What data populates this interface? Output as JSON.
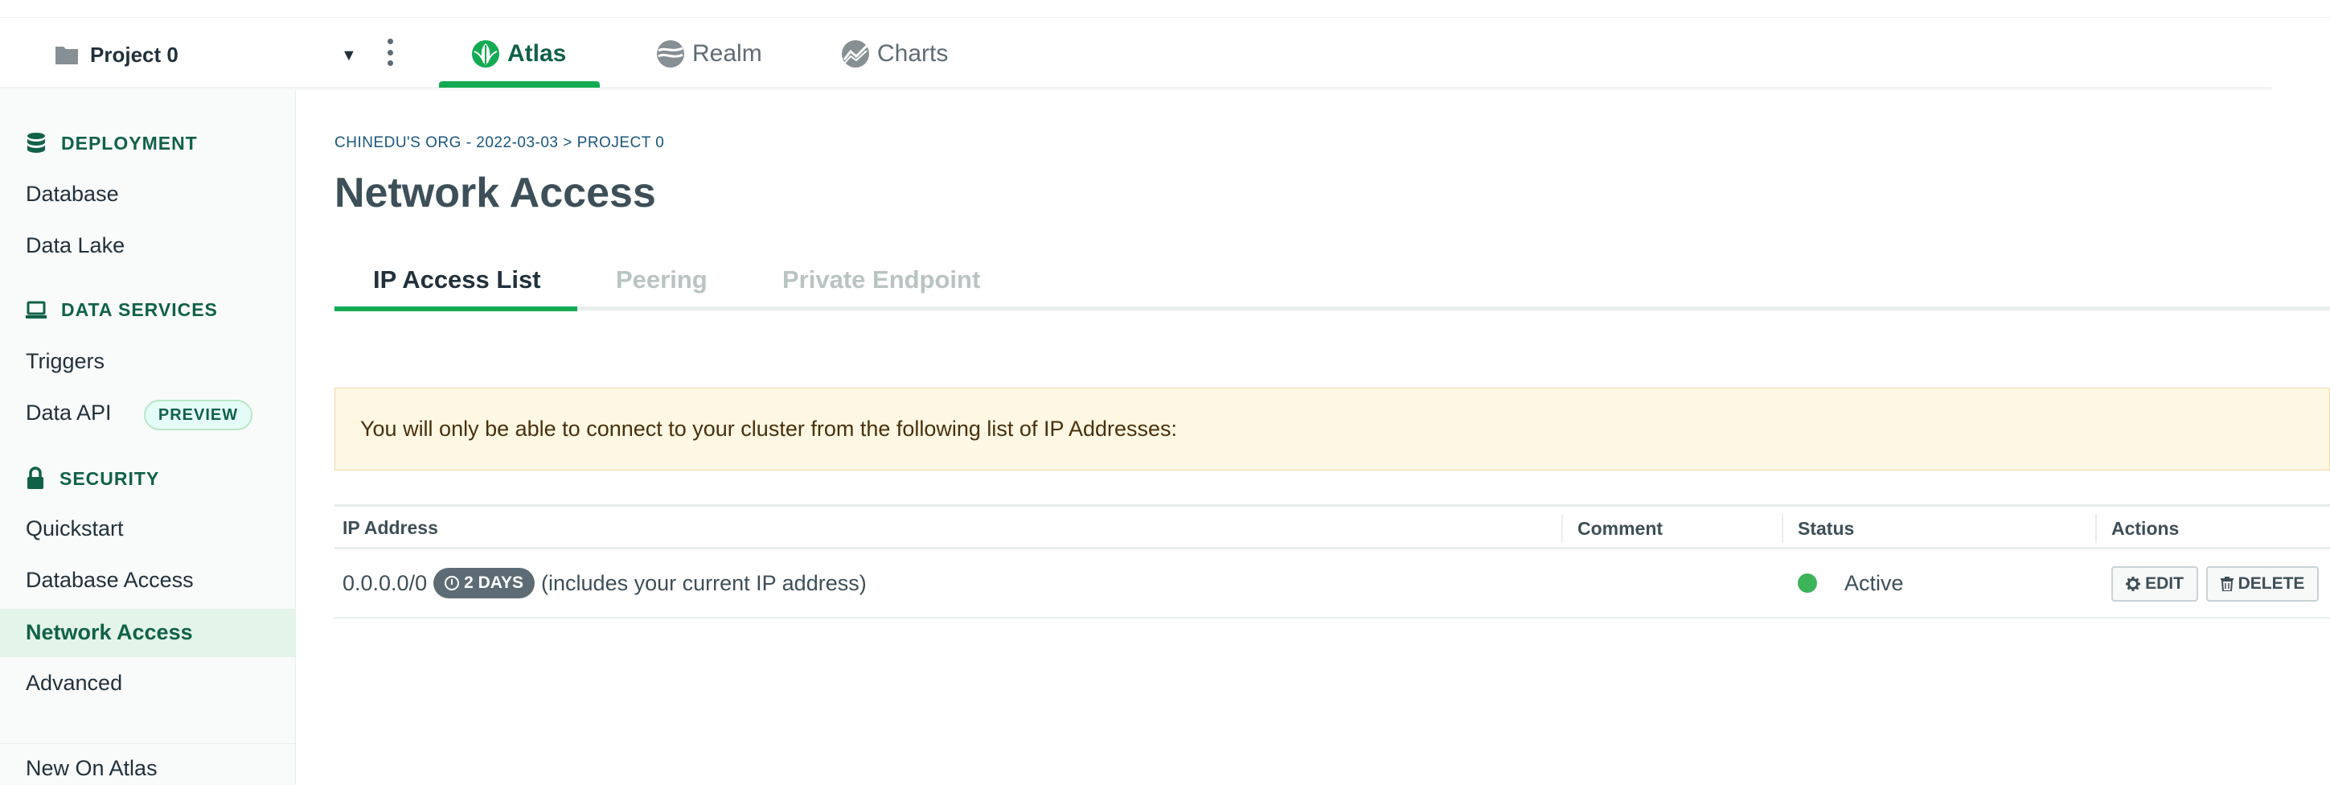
{
  "topbar": {
    "project_name": "Project 0",
    "tabs": [
      {
        "label": "Atlas",
        "active": true
      },
      {
        "label": "Realm",
        "active": false
      },
      {
        "label": "Charts",
        "active": false
      }
    ]
  },
  "sidebar": {
    "sections": [
      {
        "title": "DEPLOYMENT",
        "icon": "database-icon",
        "items": [
          "Database",
          "Data Lake"
        ]
      },
      {
        "title": "DATA SERVICES",
        "icon": "laptop-icon",
        "items": [
          "Triggers",
          "Data API"
        ]
      },
      {
        "title": "SECURITY",
        "icon": "lock-icon",
        "items": [
          "Quickstart",
          "Database Access",
          "Network Access",
          "Advanced"
        ]
      }
    ],
    "preview_badge": "PREVIEW",
    "active_item": "Network Access",
    "footer_item": "New On Atlas"
  },
  "main": {
    "breadcrumb": "CHINEDU'S ORG - 2022-03-03 > PROJECT 0",
    "title": "Network Access",
    "tabs": [
      "IP Access List",
      "Peering",
      "Private Endpoint"
    ],
    "active_tab": "IP Access List",
    "notice": "You will only be able to connect to your cluster from the following list of IP Addresses:",
    "table": {
      "headers": [
        "IP Address",
        "Comment",
        "Status",
        "Actions"
      ],
      "rows": [
        {
          "ip": "0.0.0.0/0",
          "ttl_badge": "2 DAYS",
          "note": "(includes your current IP address)",
          "comment": "",
          "status": "Active",
          "edit_label": "EDIT",
          "delete_label": "DELETE"
        }
      ]
    }
  },
  "colors": {
    "brand_green": "#13aa52",
    "dark_green": "#116149",
    "status_active": "#3db35a",
    "notice_bg": "#fef7e3"
  }
}
